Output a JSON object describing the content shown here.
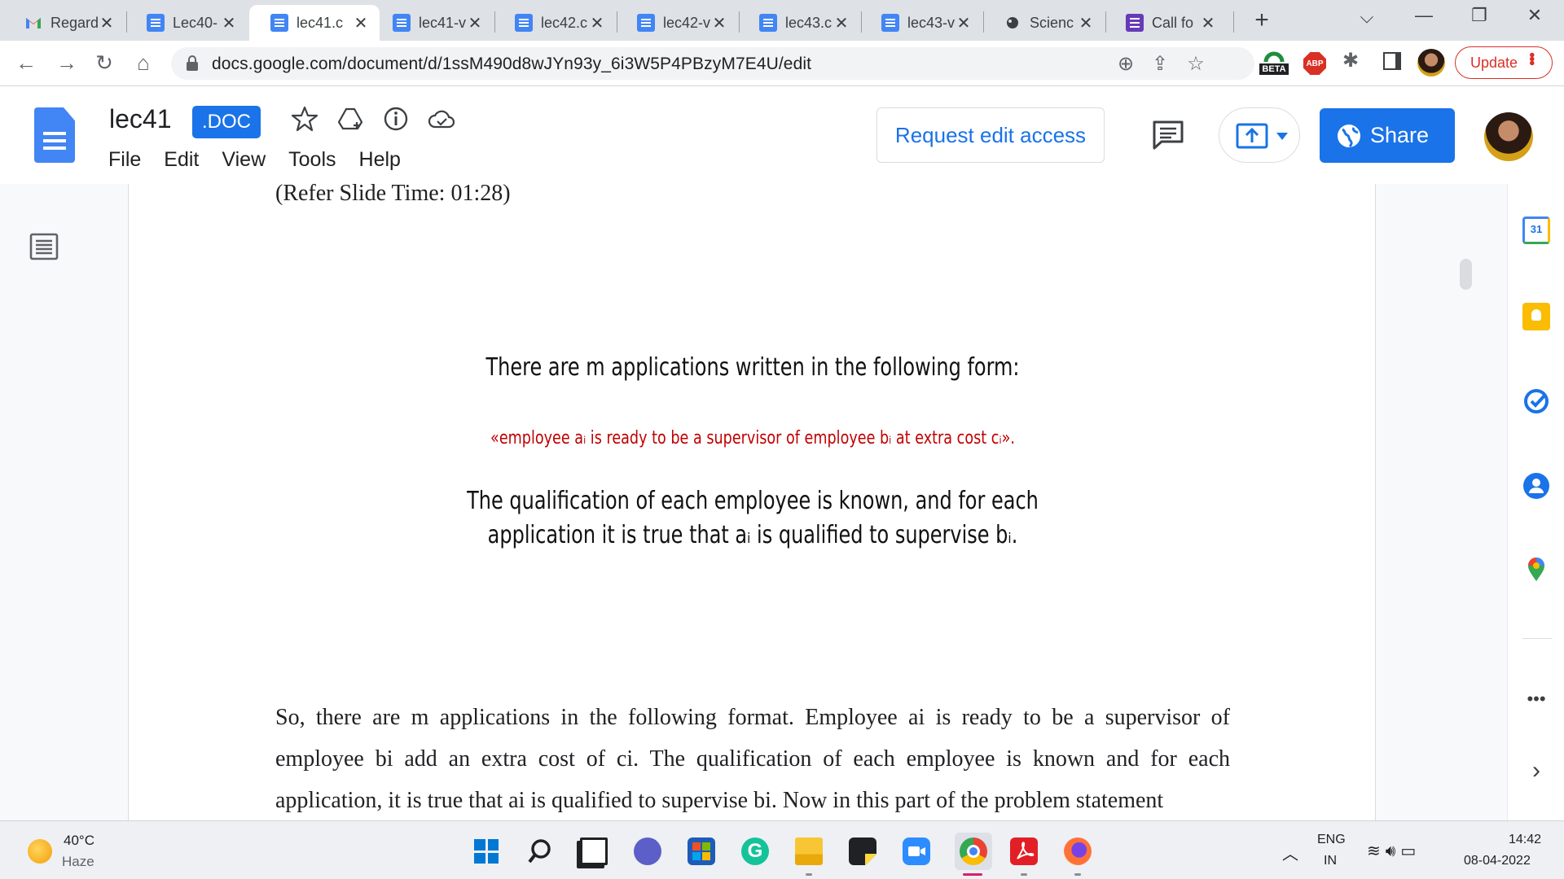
{
  "browser": {
    "tabs": [
      {
        "title": "Regard",
        "favicon": "gmail-icon"
      },
      {
        "title": "Lec40-",
        "favicon": "docs-icon"
      },
      {
        "title": "lec41.c",
        "favicon": "docs-icon",
        "active": true
      },
      {
        "title": "lec41-v",
        "favicon": "docs-icon"
      },
      {
        "title": "lec42.c",
        "favicon": "docs-icon"
      },
      {
        "title": "lec42-v",
        "favicon": "docs-icon"
      },
      {
        "title": "lec43.c",
        "favicon": "docs-icon"
      },
      {
        "title": "lec43-v",
        "favicon": "docs-icon"
      },
      {
        "title": "Scienc",
        "favicon": "science-icon"
      },
      {
        "title": "Call fo",
        "favicon": "forms-icon"
      }
    ],
    "url": "docs.google.com/document/d/1ssM490d8wJYn93y_6i3W5P4PBzyM7E4U/edit",
    "update_label": "Update",
    "beta_label": "BETA",
    "abp_label": "ABP"
  },
  "docs": {
    "title": "lec41",
    "badge": ".DOC",
    "menu": [
      "File",
      "Edit",
      "View",
      "Tools",
      "Help"
    ],
    "request_edit_label": "Request edit access",
    "share_label": "Share"
  },
  "document": {
    "slide_time": "(Refer Slide Time: 01:28)",
    "slide": {
      "heading": "There are m applications written in the following form:",
      "red_line": "«employee aᵢ is ready to be a supervisor of employee bᵢ at extra cost cᵢ».",
      "body_line1": "The qualification of each employee is known, and for each",
      "body_line2": "application it is true that aᵢ is qualified to supervise bᵢ."
    },
    "transcript": "So, there are m applications in the following format. Employee ai is ready to be a supervisor of employee bi add an extra cost of ci. The qualification of each employee is known and for each application, it is true that ai is qualified to supervise bi. Now in this part of the problem statement"
  },
  "side_panel": {
    "calendar_day": "31",
    "icons": [
      "calendar-icon",
      "keep-icon",
      "tasks-icon",
      "contacts-icon",
      "maps-icon",
      "more-icon",
      "expand-icon"
    ]
  },
  "taskbar": {
    "weather_temp": "40°C",
    "weather_desc": "Haze",
    "lang_line1": "ENG",
    "lang_line2": "IN",
    "time": "14:42",
    "date": "08-04-2022"
  },
  "colors": {
    "accent": "#1a73e8",
    "update_red": "#d93025",
    "slide_red": "#c00000"
  }
}
